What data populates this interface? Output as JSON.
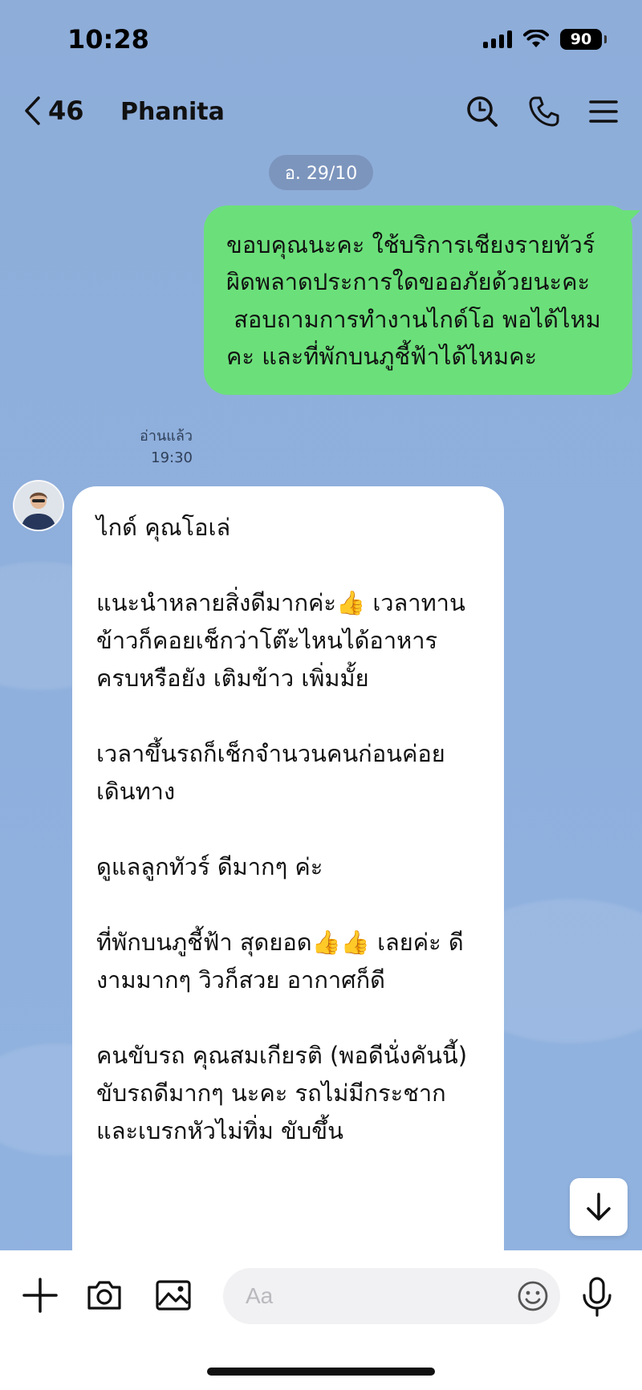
{
  "status_bar": {
    "time": "10:28",
    "battery": "90"
  },
  "header": {
    "back_count": "46",
    "title": "Phanita"
  },
  "date_pill": "อ. 29/10",
  "outgoing_message": {
    "lines": [
      "ขอบคุณนะคะ ใช้บริการเชียงรายทัวร์ ผิดพลาดประการใดขออภัยด้วยนะคะ",
      " สอบถามการทำงานไกด์โอ พอได้ไหมคะ และที่พักบนภูชี้ฟ้าได้ไหมคะ"
    ],
    "read_label": "อ่านแล้ว",
    "time": "19:30"
  },
  "incoming_message": {
    "paragraphs": [
      "ไกด์ คุณโอเล่",
      "แนะนำหลายสิ่งดีมากค่ะ👍 เวลาทานข้าวก็คอยเช็กว่าโต๊ะไหนได้อาหารครบหรือยัง เติมข้าว เพิ่มมั้ย",
      "เวลาขึ้นรถก็เช็กจำนวนคนก่อนค่อยเดินทาง",
      "ดูแลลูกทัวร์ ดีมากๆ ค่ะ",
      "ที่พักบนภูชี้ฟ้า สุดยอด👍👍 เลยค่ะ ดีงามมากๆ วิวก็สวย อากาศก็ดี",
      "คนขับรถ คุณสมเกียรติ (พอดีนั่งคันนี้) ขับรถดีมากๆ นะคะ รถไม่มีกระชากและเบรกหัวไม่ทิ่ม ขับขึ้น"
    ]
  },
  "input": {
    "placeholder": "Aa"
  },
  "icons": {
    "back": "chevron-left-icon",
    "search": "search-icon",
    "call": "phone-icon",
    "menu": "menu-icon",
    "add": "plus-icon",
    "camera": "camera-icon",
    "image": "image-icon",
    "emoji": "emoji-icon",
    "mic": "microphone-icon",
    "scroll": "arrow-down-icon"
  },
  "colors": {
    "background": "#8faedb",
    "outgoing_bubble": "#6be07a",
    "incoming_bubble": "#ffffff"
  }
}
